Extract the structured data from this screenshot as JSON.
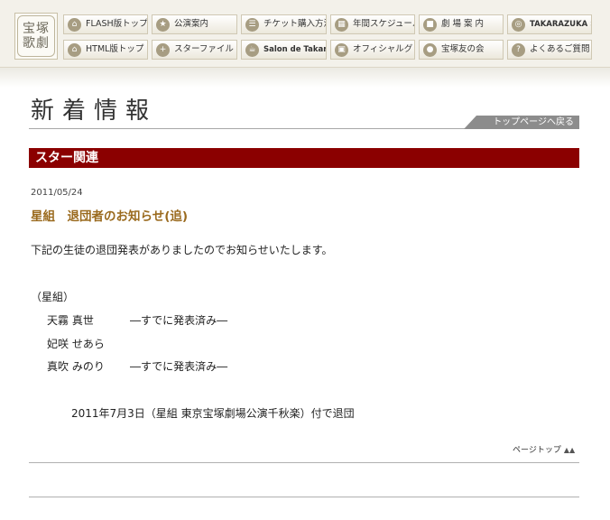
{
  "header": {
    "logo_text": "宝塚歌劇",
    "nav": [
      {
        "label": "FLASH版トップ",
        "icon": "house-icon",
        "glyph": "⌂"
      },
      {
        "label": "公演案内",
        "icon": "star-icon",
        "glyph": "★"
      },
      {
        "label": "チケット購入方法",
        "icon": "ticket-icon",
        "glyph": "☰"
      },
      {
        "label": "年間スケジュール",
        "icon": "calendar-icon",
        "glyph": "▦"
      },
      {
        "label": "劇 場 案 内",
        "icon": "theater-icon",
        "glyph": "■"
      },
      {
        "label": "TAKARAZUKA SKY STAGE",
        "icon": "sky-stage-icon",
        "glyph": "◎"
      },
      {
        "label": "HTML版トップ",
        "icon": "house-icon",
        "glyph": "⌂"
      },
      {
        "label": "スターファイル",
        "icon": "plus-icon",
        "glyph": "+"
      },
      {
        "label": "Salon de Takarazuka",
        "icon": "salon-icon",
        "glyph": "☕"
      },
      {
        "label": "オフィシャルグッズ",
        "icon": "goods-icon",
        "glyph": "▣"
      },
      {
        "label": "宝塚友の会",
        "icon": "person-icon",
        "glyph": "●"
      },
      {
        "label": "よくあるご質問",
        "icon": "question-icon",
        "glyph": "?"
      }
    ]
  },
  "main": {
    "page_title": "新着情報",
    "top_link": "トップページへ戻る",
    "category": "スター関連",
    "date": "2011/05/24",
    "article_title": "星組　退団者のお知らせ(追)",
    "intro": "下記の生徒の退団発表がありましたのでお知らせいたします。",
    "group_label": "（星組）",
    "members": [
      {
        "name": "天霧 真世",
        "note": "―すでに発表済み―"
      },
      {
        "name": "妃咲 せあら",
        "note": ""
      },
      {
        "name": "真吹 みのり",
        "note": "―すでに発表済み―"
      }
    ],
    "retire_note": "2011年7月3日（星組 東京宝塚劇場公演千秋楽）付で退団",
    "page_top": "ページトップ",
    "page_top_icon": "triangle-up-icon"
  },
  "colors": {
    "category_bar": "#8b0000",
    "article_title": "#9a6a1e",
    "top_link_bg": "#8c8c8c"
  }
}
